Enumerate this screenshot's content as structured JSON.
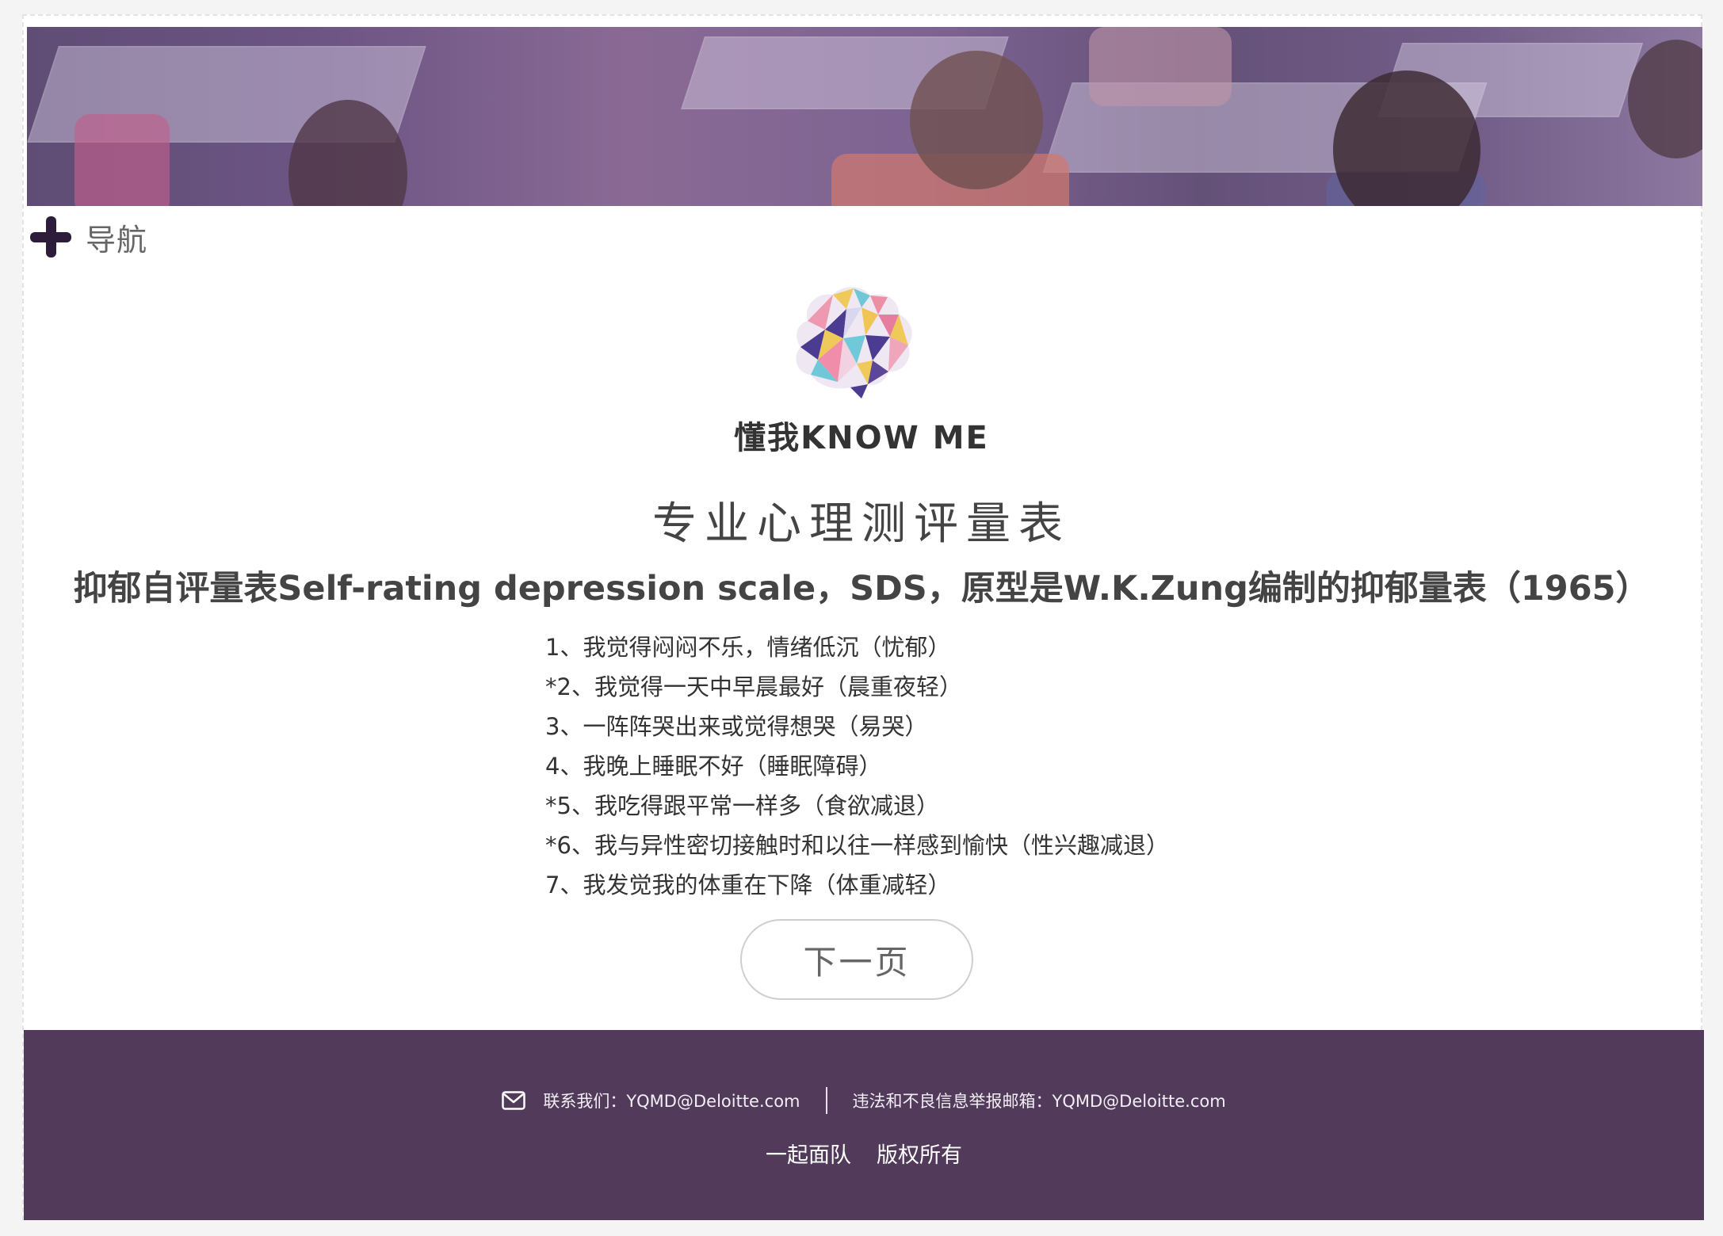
{
  "nav": {
    "toggle_label": "导航"
  },
  "brand": {
    "name": "懂我KNOW ME"
  },
  "content": {
    "section_title": "专业心理测评量表",
    "subtitle": "抑郁自评量表Self-rating depression scale，SDS，原型是W.K.Zung编制的抑郁量表（1965）",
    "questions": [
      "1、我觉得闷闷不乐，情绪低沉（忧郁）",
      "*2、我觉得一天中早晨最好（晨重夜轻）",
      "3、一阵阵哭出来或觉得想哭（易哭）",
      "4、我晚上睡眠不好（睡眠障碍）",
      "*5、我吃得跟平常一样多（食欲减退）",
      "*6、我与异性密切接触时和以往一样感到愉快（性兴趣减退）",
      "7、我发觉我的体重在下降（体重减轻）"
    ],
    "next_button": "下一页"
  },
  "footer": {
    "contact_label": "联系我们：YQMD@Deloitte.com",
    "report_label": "违法和不良信息举报邮箱：YQMD@Deloitte.com",
    "links": [
      "一起面队",
      "版权所有"
    ]
  },
  "theme": {
    "primary": "#523a5a",
    "accent_dark": "#2d1d3a"
  }
}
